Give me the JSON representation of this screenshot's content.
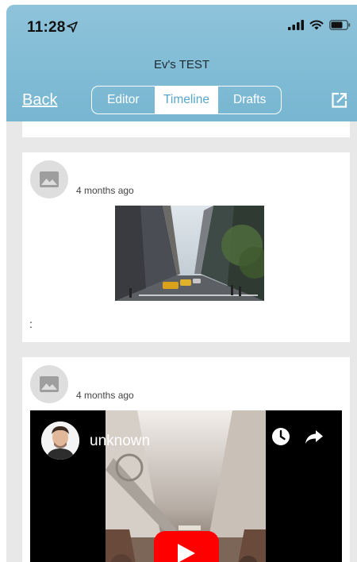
{
  "status_bar": {
    "time": "11:28"
  },
  "nav": {
    "title": "Ev's TEST",
    "back_label": "Back",
    "tabs": [
      {
        "label": "Editor",
        "active": false
      },
      {
        "label": "Timeline",
        "active": true
      },
      {
        "label": "Drafts",
        "active": false
      }
    ]
  },
  "posts": [
    {
      "time_ago": "4 months ago",
      "media": "photo",
      "caption": ":"
    },
    {
      "time_ago": "4 months ago",
      "media": "video",
      "video_title": "unknown"
    }
  ],
  "colors": {
    "header": "#7ab8d3",
    "active_tab_text": "#5aa6c8",
    "background": "#e8e8e8",
    "card": "#ffffff",
    "play_button": "#ff0000"
  }
}
